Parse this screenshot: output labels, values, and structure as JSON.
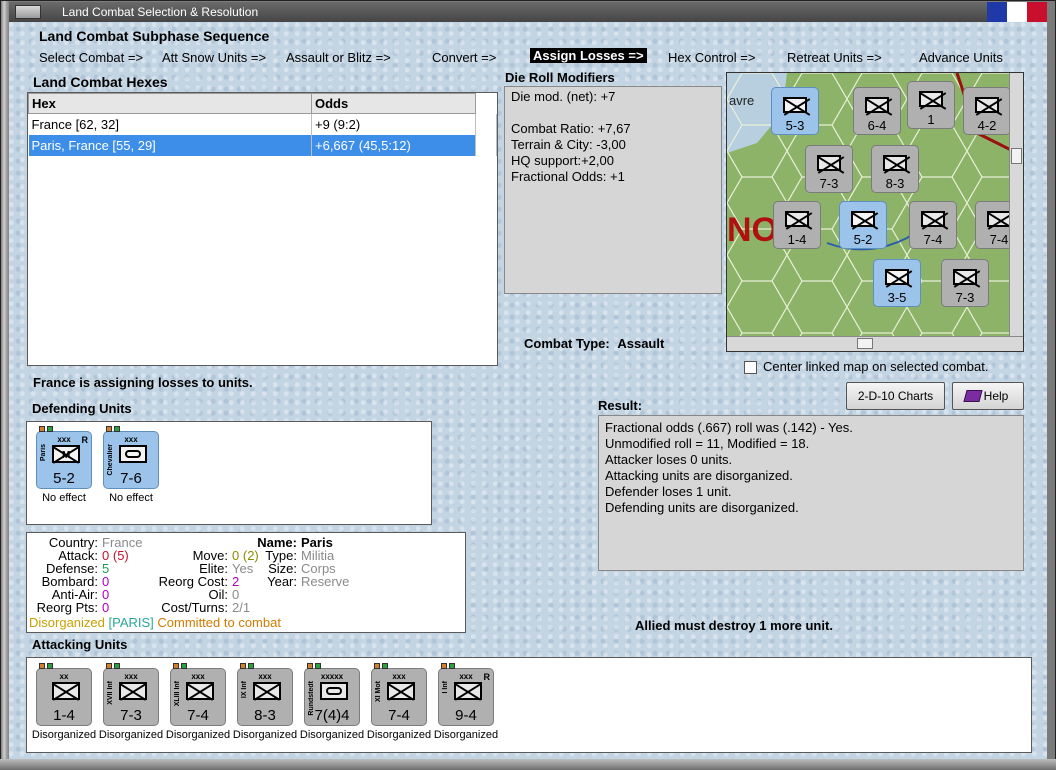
{
  "window": {
    "title": "Land Combat Selection & Resolution",
    "flag_colors": [
      "#1f3aa8",
      "#ffffff",
      "#c8102e"
    ]
  },
  "subphase": {
    "heading": "Land Combat Subphase Sequence",
    "steps": [
      {
        "label": "Select Combat =>",
        "active": false
      },
      {
        "label": "Att Snow Units =>",
        "active": false
      },
      {
        "label": "Assault or Blitz =>",
        "active": false
      },
      {
        "label": "Convert =>",
        "active": false
      },
      {
        "label": "Assign Losses =>",
        "active": true
      },
      {
        "label": "Hex Control =>",
        "active": false
      },
      {
        "label": "Retreat Units =>",
        "active": false
      },
      {
        "label": "Advance Units",
        "active": false
      }
    ]
  },
  "combat_hexes": {
    "heading": "Land Combat Hexes",
    "columns": [
      "Hex",
      "Odds"
    ],
    "rows": [
      {
        "hex": "France [62, 32]",
        "odds": "+9 (9:2)",
        "selected": false
      },
      {
        "hex": "Paris, France [55, 29]",
        "odds": "+6,667 (45,5:12)",
        "selected": true
      }
    ]
  },
  "die_roll": {
    "heading": "Die Roll Modifiers",
    "lines": [
      "Die mod. (net): +7",
      "",
      "Combat Ratio: +7,67",
      "Terrain & City: -3,00",
      "HQ support:+2,00",
      "Fractional Odds: +1"
    ]
  },
  "combat_type": {
    "label": "Combat Type:",
    "value": "Assault"
  },
  "map": {
    "center_checkbox_label": "Center linked map on selected combat.",
    "center_checked": false,
    "labels": [
      "avre",
      "NO"
    ]
  },
  "status_message": "France is assigning losses to units.",
  "defending": {
    "heading": "Defending Units",
    "units": [
      {
        "size": "xxx",
        "name": "Paris",
        "strength": "5-2",
        "badge": "M",
        "flag": "R",
        "caption": "No effect",
        "type": "inf"
      },
      {
        "size": "xxx",
        "name": "Chevalier",
        "strength": "7-6",
        "badge": "",
        "flag": "",
        "caption": "No effect",
        "type": "armor"
      }
    ]
  },
  "unit_details": {
    "country_label": "Country:",
    "country": "France",
    "attack_label": "Attack:",
    "attack": "0",
    "attack_extra": "(5)",
    "defense_label": "Defense:",
    "defense": "5",
    "bombard_label": "Bombard:",
    "bombard": "0",
    "antiair_label": "Anti-Air:",
    "antiair": "0",
    "reorgpts_label": "Reorg Pts:",
    "reorgpts": "0",
    "name_label": "Name:",
    "name": "Paris",
    "move_label": "Move:",
    "move": "0",
    "move_extra": "(2)",
    "type_label": "Type:",
    "type": "Militia",
    "elite_label": "Elite:",
    "elite": "Yes",
    "size_label": "Size:",
    "size": "Corps",
    "reorgcost_label": "Reorg Cost:",
    "reorgcost": "2",
    "year_label": "Year:",
    "year": "Reserve",
    "oil_label": "Oil:",
    "oil": "0",
    "costturns_label": "Cost/Turns:",
    "costturns": "2/1",
    "status_disorg": "Disorganized",
    "status_home": "[PARIS]",
    "status_committed": "Committed to combat"
  },
  "result": {
    "heading": "Result:",
    "lines": [
      "Fractional odds (.667) roll was (.142)  - Yes.",
      "Unmodified roll = 11, Modified = 18.",
      "Attacker loses 0 units.",
      "Attacking units are disorganized.",
      "Defender loses 1 unit.",
      "Defending units are disorganized."
    ]
  },
  "buttons": {
    "charts": "2-D-10 Charts",
    "help": "Help"
  },
  "must_destroy": "Allied must destroy 1 more unit.",
  "attacking": {
    "heading": "Attacking Units",
    "units": [
      {
        "size": "xx",
        "name": "",
        "strength": "1-4",
        "caption": "Disorganized",
        "type": "inf",
        "flag": ""
      },
      {
        "size": "xxx",
        "name": "XVII Inf",
        "strength": "7-3",
        "caption": "Disorganized",
        "type": "inf",
        "flag": ""
      },
      {
        "size": "xxx",
        "name": "XLIII Inf",
        "strength": "7-4",
        "caption": "Disorganized",
        "type": "inf",
        "flag": ""
      },
      {
        "size": "xxx",
        "name": "IX Inf",
        "strength": "8-3",
        "caption": "Disorganized",
        "type": "inf",
        "flag": ""
      },
      {
        "size": "xxxxx",
        "name": "Rundstedt",
        "strength": "7(4)4",
        "caption": "Disorganized",
        "type": "armor",
        "flag": ""
      },
      {
        "size": "xxx",
        "name": "XI Mot",
        "strength": "7-4",
        "caption": "Disorganized",
        "type": "inf",
        "flag": ""
      },
      {
        "size": "xxx",
        "name": "I Inf",
        "strength": "9-4",
        "caption": "Disorganized",
        "type": "inf",
        "flag": "R"
      }
    ]
  },
  "map_counters": [
    {
      "strength": "5-3",
      "blue": true
    },
    {
      "strength": "6-4",
      "blue": false
    },
    {
      "strength": "1",
      "blue": false
    },
    {
      "strength": "4-2",
      "blue": false
    },
    {
      "strength": "7-3",
      "blue": false
    },
    {
      "strength": "8-3",
      "blue": false
    },
    {
      "strength": "1-4",
      "blue": false
    },
    {
      "strength": "5-2",
      "blue": true
    },
    {
      "strength": "7-4",
      "blue": false
    },
    {
      "strength": "7-4",
      "blue": false
    },
    {
      "strength": "3-5",
      "blue": true
    },
    {
      "strength": "7-3",
      "blue": false
    }
  ]
}
